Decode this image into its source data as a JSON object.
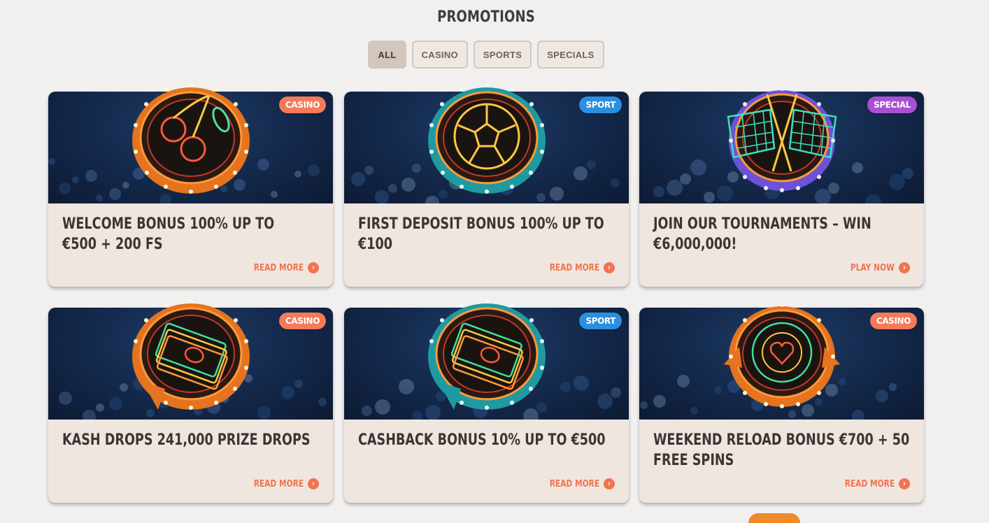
{
  "page": {
    "title": "PROMOTIONS"
  },
  "filters": [
    {
      "label": "ALL",
      "active": true
    },
    {
      "label": "CASINO",
      "active": false
    },
    {
      "label": "SPORTS",
      "active": false
    },
    {
      "label": "SPECIALS",
      "active": false
    }
  ],
  "colors": {
    "casino_tag": "#f47a5a",
    "sport_tag": "#2a8fe0",
    "special_tag": "#a94fd3",
    "link": "#f2734e",
    "ring_orange": "#f08a2b",
    "ring_teal": "#2aa6a8",
    "ring_purple": "#7a5ee0"
  },
  "cards": [
    {
      "tag": "CASINO",
      "title": "WELCOME BONUS 100% UP TO €500 + 200 FS",
      "link": "READ MORE",
      "icon": "cherry-icon",
      "ring": "orange"
    },
    {
      "tag": "SPORT",
      "title": "FIRST DEPOSIT BONUS 100% UP TO €100",
      "link": "READ MORE",
      "icon": "soccer-ball-icon",
      "ring": "teal"
    },
    {
      "tag": "SPECIAL",
      "title": "JOIN OUR TOURNAMENTS – WIN €6,000,000!",
      "link": "PLAY NOW",
      "icon": "racing-flags-icon",
      "ring": "purple"
    },
    {
      "tag": "CASINO",
      "title": "KASH DROPS 241,000 PRIZE DROPS",
      "link": "READ MORE",
      "icon": "money-icon",
      "ring": "orange"
    },
    {
      "tag": "SPORT",
      "title": "CASHBACK BONUS 10% UP TO €500",
      "link": "READ MORE",
      "icon": "money-icon",
      "ring": "teal"
    },
    {
      "tag": "CASINO",
      "title": "WEEKEND RELOAD BONUS €700 + 50 FREE SPINS",
      "link": "READ MORE",
      "icon": "poker-chip-icon",
      "ring": "orange"
    }
  ]
}
